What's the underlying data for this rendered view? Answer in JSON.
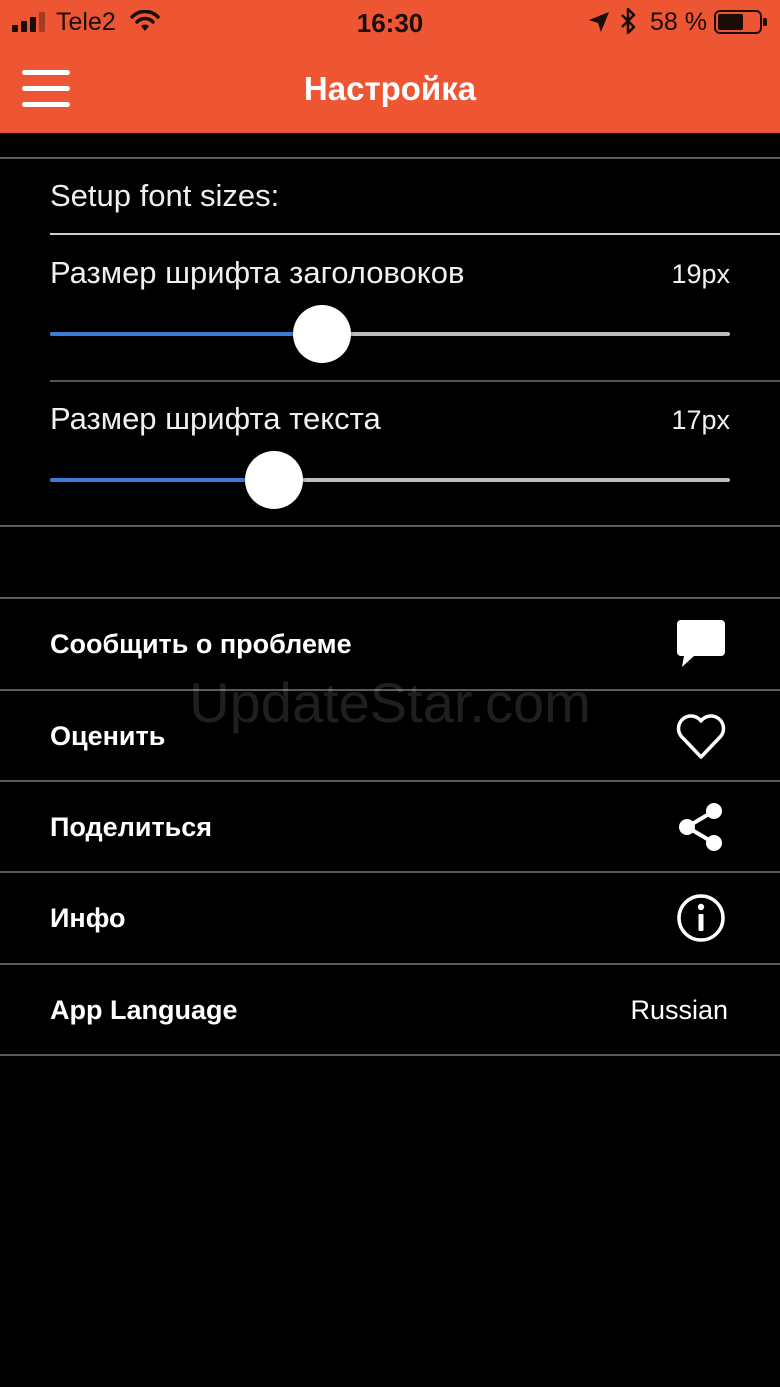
{
  "status_bar": {
    "carrier": "Tele2",
    "time": "16:30",
    "battery_percent": "58 %"
  },
  "header": {
    "title": "Настройка",
    "menu_icon": "hamburger-menu-icon"
  },
  "font_sizes": {
    "section_title": "Setup font sizes:",
    "sliders": [
      {
        "label": "Размер шрифта заголовоков",
        "value": "19px",
        "level": 0.4
      },
      {
        "label": "Размер шрифта текста",
        "value": "17px",
        "level": 0.33
      }
    ]
  },
  "menu": {
    "items": [
      {
        "label": "Сообщить о проблеме",
        "icon": "speech-bubble-icon"
      },
      {
        "label": "Оценить",
        "icon": "heart-icon"
      },
      {
        "label": "Поделиться",
        "icon": "share-icon"
      },
      {
        "label": "Инфо",
        "icon": "info-icon"
      },
      {
        "label": "App Language",
        "value": "Russian"
      }
    ]
  },
  "watermark": "UpdateStar.com",
  "colors": {
    "accent": "#EE5533",
    "slider_fill": "#3A7BD5",
    "background": "#000000"
  }
}
